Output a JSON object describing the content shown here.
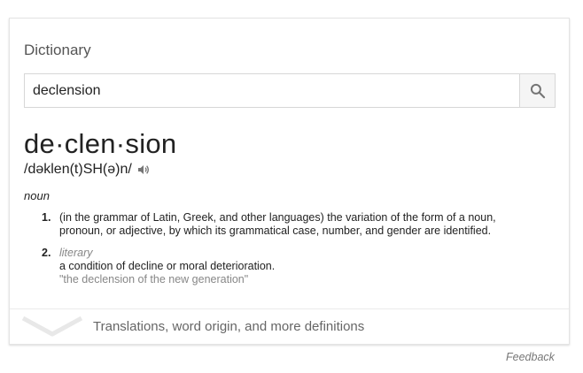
{
  "header": {
    "title": "Dictionary"
  },
  "search": {
    "value": "declension"
  },
  "entry": {
    "word": "de·clen·sion",
    "phonetic": "/dəklen(t)SH(ə)n/",
    "part_of_speech": "noun",
    "definitions": [
      {
        "number": "1.",
        "text": "(in the grammar of Latin, Greek, and other languages) the variation of the form of a noun, pronoun, or adjective, by which its grammatical case, number, and gender are identified."
      },
      {
        "number": "2.",
        "register": "literary",
        "text": "a condition of decline or moral deterioration.",
        "example": "\"the declension of the new generation\""
      }
    ]
  },
  "more": {
    "label": "Translations, word origin, and more definitions"
  },
  "footer": {
    "feedback": "Feedback"
  },
  "icons": {
    "search": "search-icon",
    "speaker": "speaker-icon",
    "expand": "chevron-down-icon"
  },
  "colors": {
    "text": "#222222",
    "muted": "#878787",
    "icon": "#757575"
  }
}
